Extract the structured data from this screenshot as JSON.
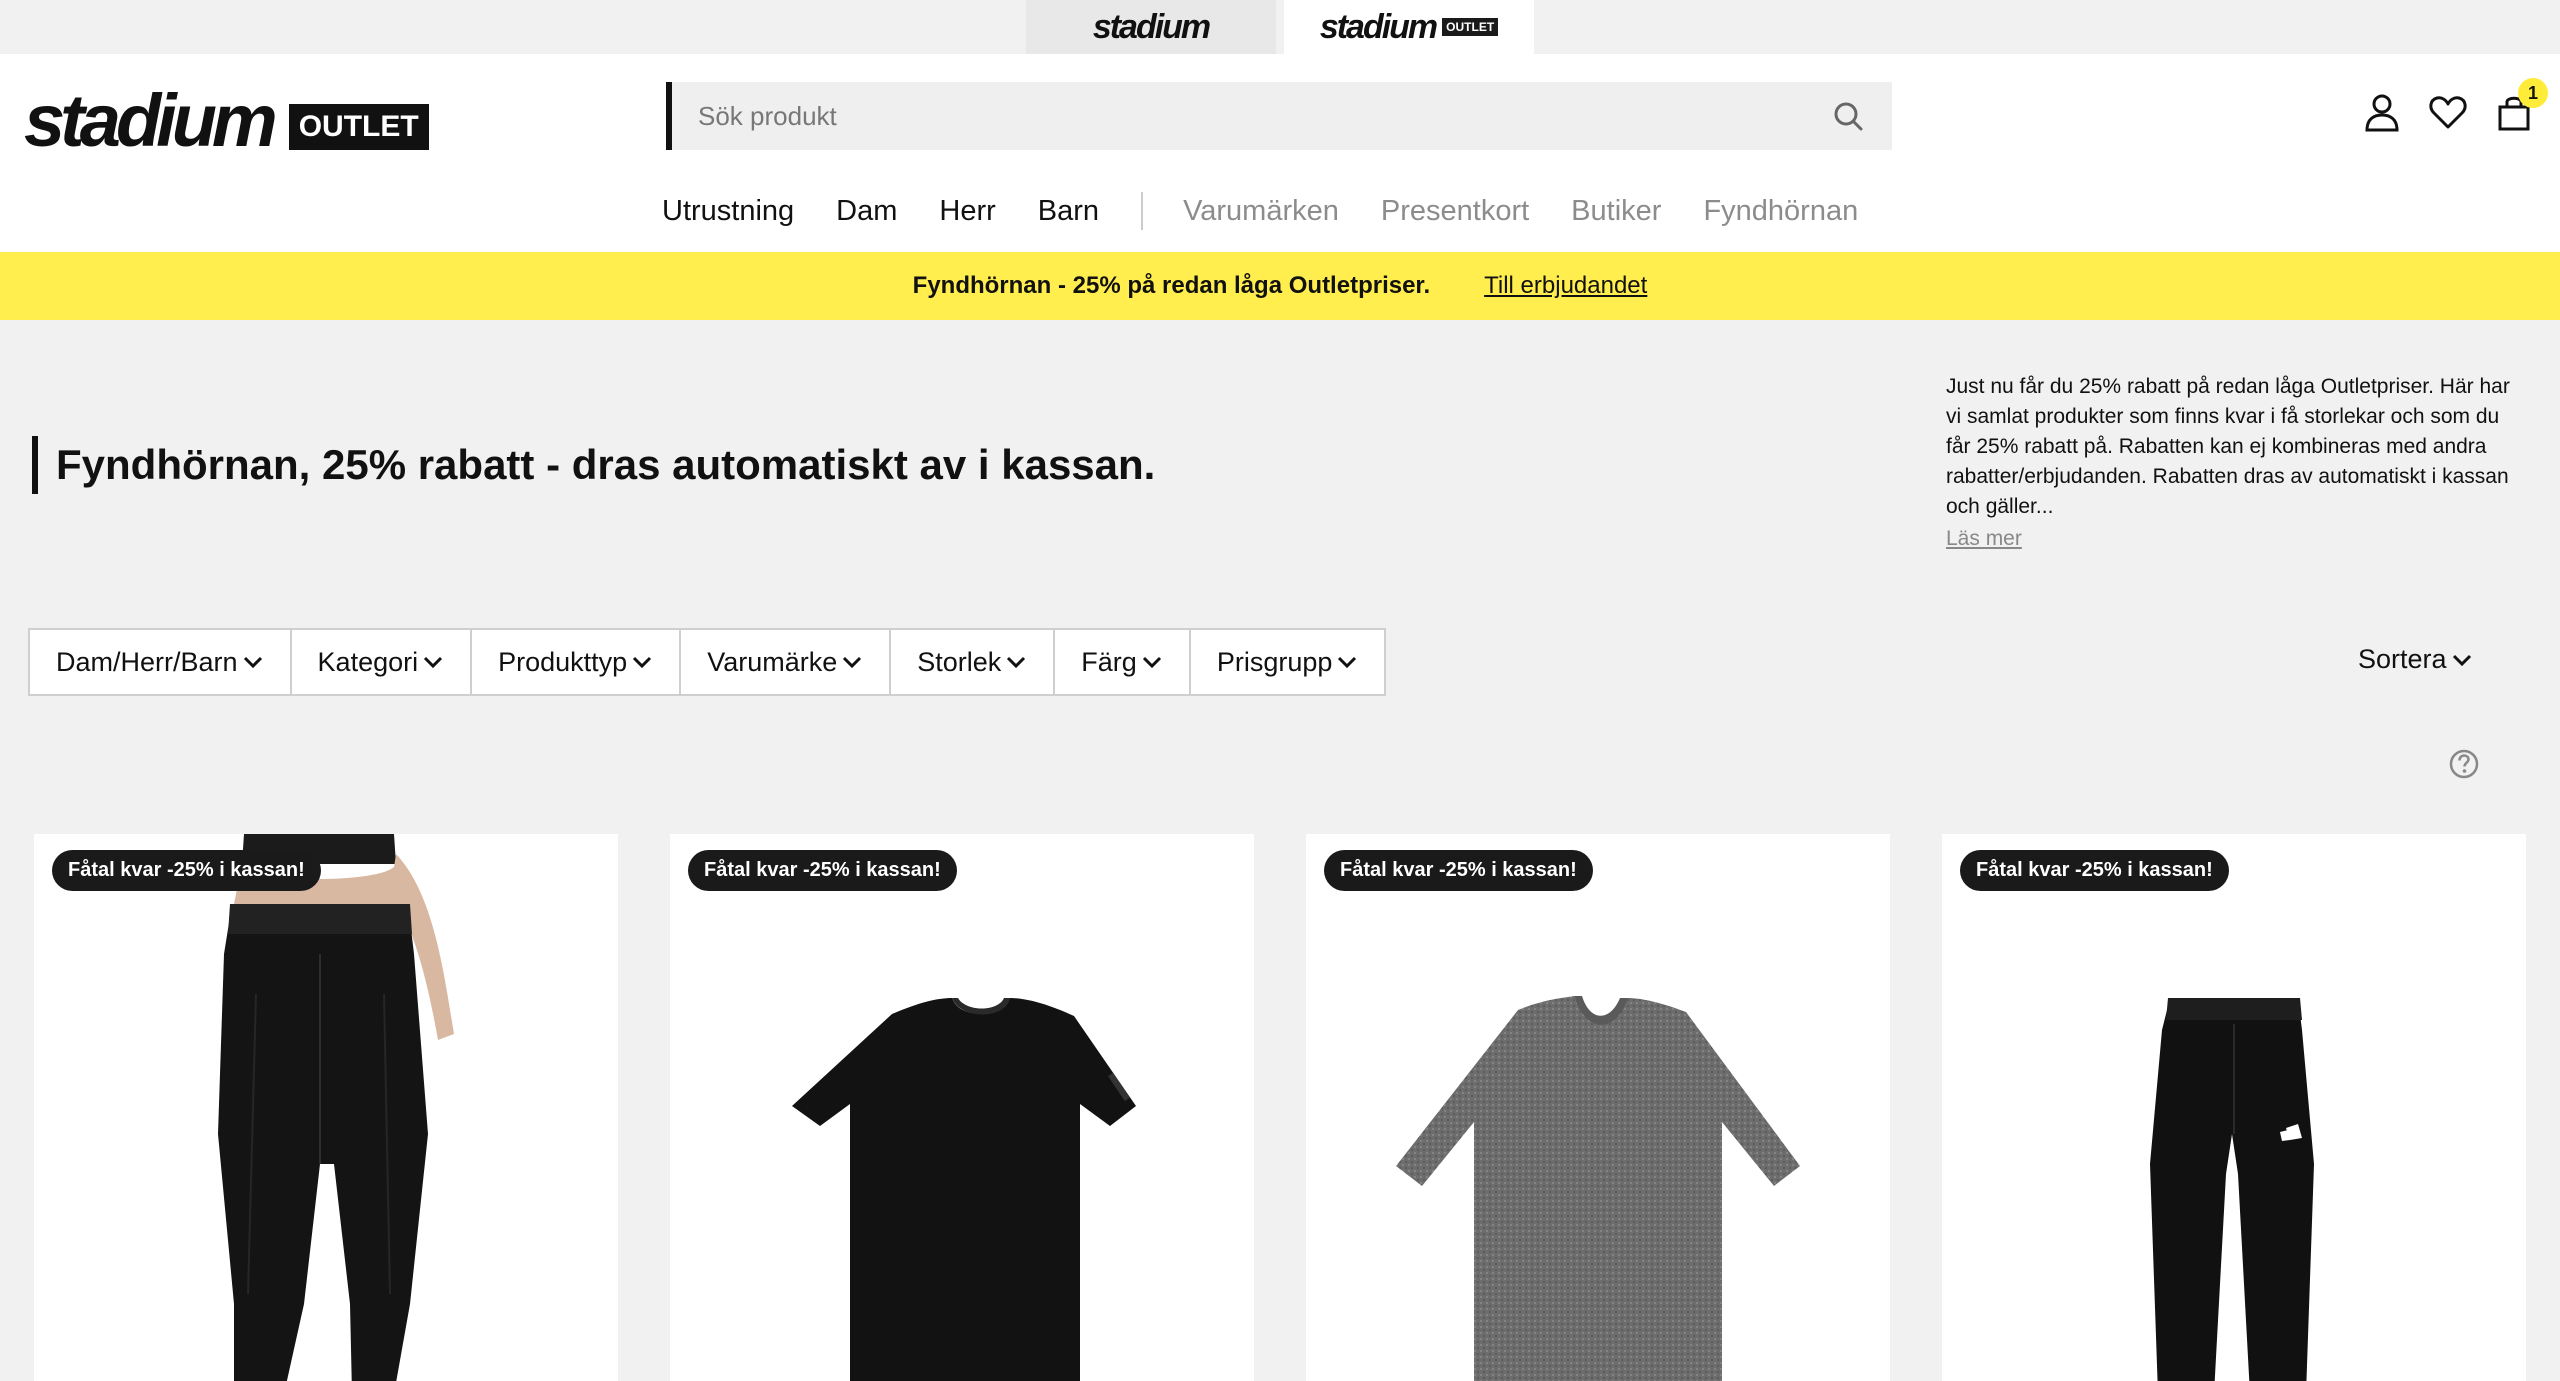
{
  "store_switch": {
    "stadium": "stadium",
    "outlet": "stadium",
    "outlet_tag": "OUTLET"
  },
  "header": {
    "logo_text": "stadium",
    "logo_outlet": "OUTLET",
    "search_placeholder": "Sök produkt",
    "cart_count": "1"
  },
  "nav": {
    "items": [
      "Utrustning",
      "Dam",
      "Herr",
      "Barn"
    ],
    "secondary": [
      "Varumärken",
      "Presentkort",
      "Butiker",
      "Fyndhörnan"
    ]
  },
  "promo": {
    "text": "Fyndhörnan - 25% på redan låga Outletpriser.",
    "link": "Till erbjudandet"
  },
  "page": {
    "heading": "Fyndhörnan, 25% rabatt - dras automatiskt av i kassan.",
    "description": "Just nu får du 25% rabatt på redan låga Outletpriser. Här har vi samlat produkter som finns kvar i få storlekar och som du får 25% rabatt på. Rabatten kan ej kombineras med andra rabatter/erbjudanden. Rabatten dras av automatiskt i kassan och gäller...",
    "read_more": "Läs mer"
  },
  "filters": [
    "Dam/Herr/Barn",
    "Kategori",
    "Produkttyp",
    "Varumärke",
    "Storlek",
    "Färg",
    "Prisgrupp"
  ],
  "sort_label": "Sortera",
  "products": [
    {
      "badge": "Fåtal kvar -25% i kassan!",
      "image": "black-cropped-tights"
    },
    {
      "badge": "Fåtal kvar -25% i kassan!",
      "image": "black-tshirt"
    },
    {
      "badge": "Fåtal kvar -25% i kassan!",
      "image": "grey-tshirt"
    },
    {
      "badge": "Fåtal kvar -25% i kassan!",
      "image": "black-adidas-tights"
    }
  ],
  "colors": {
    "promo_yellow": "#ffee4d",
    "badge_yellow": "#ffec38",
    "background": "#f1f1f1"
  }
}
